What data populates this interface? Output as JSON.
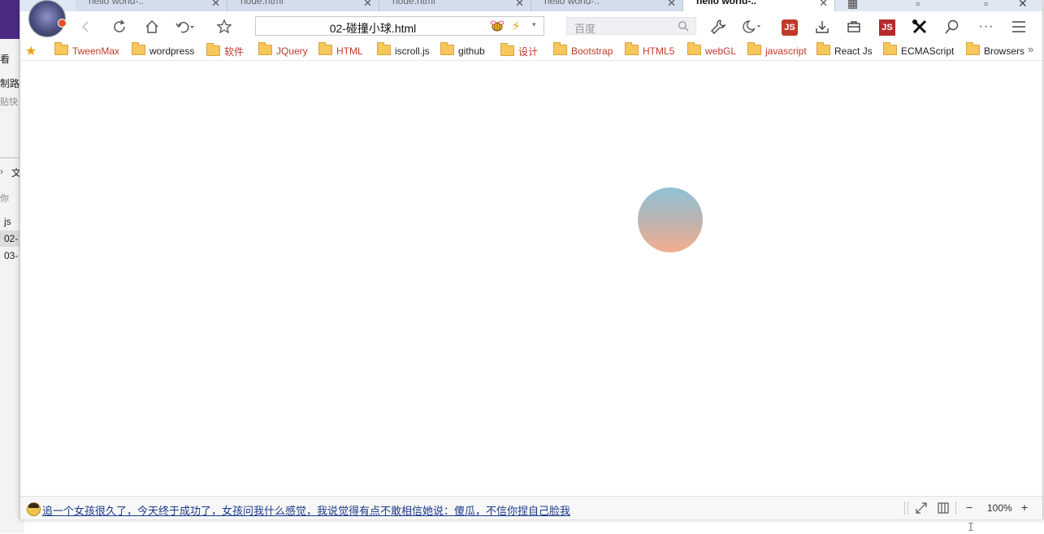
{
  "background_app": {
    "lines": [
      "看",
      "制路",
      "贴快",
      "文",
      "你",
      "js",
      "02-",
      "03-"
    ]
  },
  "tabs": [
    {
      "label": "hello world-..",
      "close": "✕"
    },
    {
      "label": "node.html",
      "close": "✕"
    },
    {
      "label": "node.html",
      "close": "✕"
    },
    {
      "label": "hello world-..",
      "close": "✕"
    },
    {
      "label": "hello world-..",
      "close": "✕",
      "active": true
    }
  ],
  "address_bar": {
    "url": "02-碰撞小球.html",
    "dropdown": "▾"
  },
  "search_box": {
    "placeholder": "百度"
  },
  "extensions": {
    "js_label": "JS",
    "more": "···"
  },
  "bookmarks": {
    "star": "★",
    "items": [
      {
        "label": "TweenMax",
        "color": "#c0392b"
      },
      {
        "label": "wordpress",
        "color": "#222222"
      },
      {
        "label": "软件",
        "color": "#c0392b"
      },
      {
        "label": "JQuery",
        "color": "#c0392b"
      },
      {
        "label": "HTML",
        "color": "#c0392b"
      },
      {
        "label": "iscroll.js",
        "color": "#222222"
      },
      {
        "label": "github",
        "color": "#222222"
      },
      {
        "label": "设计",
        "color": "#c0392b"
      },
      {
        "label": "Bootstrap",
        "color": "#c0392b"
      },
      {
        "label": "HTML5",
        "color": "#c0392b"
      },
      {
        "label": "webGL",
        "color": "#c0392b"
      },
      {
        "label": "javascript",
        "color": "#c0392b"
      },
      {
        "label": "React Js",
        "color": "#222222"
      },
      {
        "label": "ECMAScript",
        "color": "#222222"
      },
      {
        "label": "Browsers",
        "color": "#222222"
      }
    ],
    "more": "»"
  },
  "page": {
    "ball_colors": [
      "#8fc3d6",
      "#f3ad8f"
    ]
  },
  "status_bar": {
    "news_text": "追一个女孩很久了，今天终于成功了，女孩问我什么感觉，我说觉得有点不敢相信她说：傻瓜，不信你捏自己脸我",
    "zoom": "100%",
    "zoom_out": "−",
    "zoom_in": "+"
  }
}
